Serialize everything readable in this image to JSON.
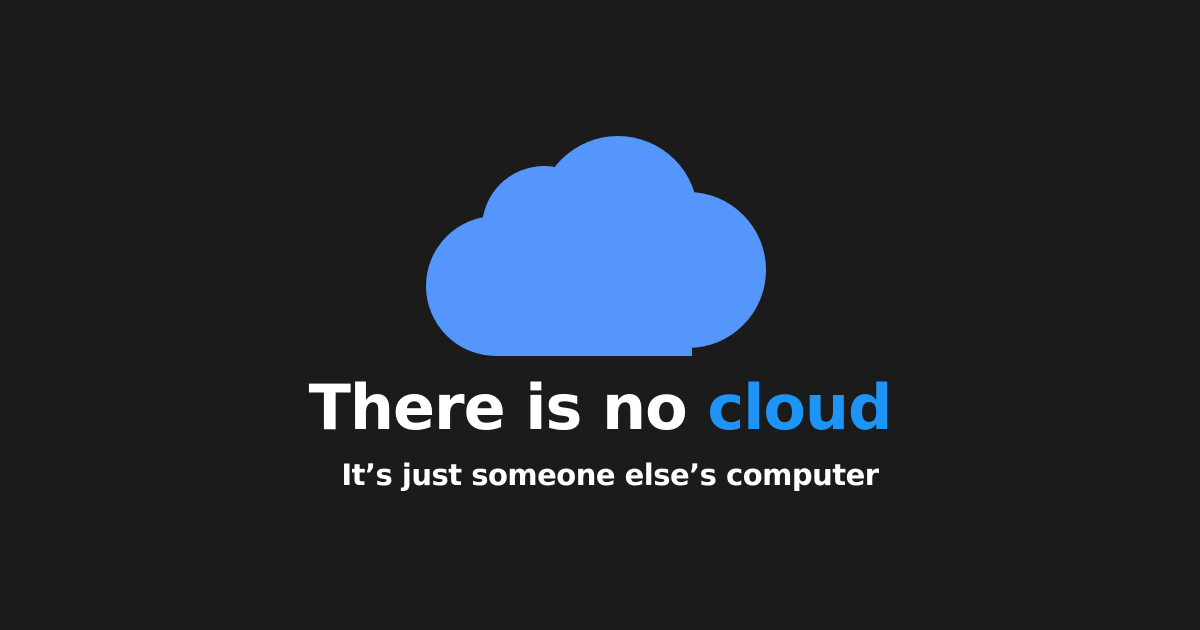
{
  "headline": {
    "prefix": "There is no ",
    "accent_word": "cloud"
  },
  "subline": "It’s just someone else’s computer",
  "icons": {
    "main": "cloud-icon"
  },
  "colors": {
    "background": "#1b1b1c",
    "cloud": "#5596fc",
    "accent_text": "#1e94f7",
    "text": "#ffffff"
  }
}
